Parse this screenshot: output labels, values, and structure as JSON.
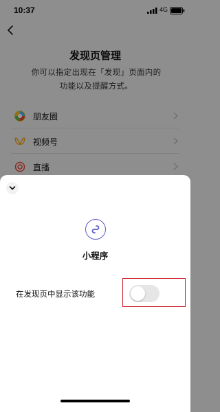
{
  "status_bar": {
    "time": "10:37",
    "network": "4G"
  },
  "nav": {
    "back_icon": "chevron-left-icon"
  },
  "page": {
    "title": "发现页管理",
    "description": "你可以指定出现在「发现」页面内的功能以及提醒方式。"
  },
  "menu": {
    "items": [
      {
        "label": "朋友圈",
        "icon": "moments-icon"
      },
      {
        "label": "视频号",
        "icon": "channels-icon"
      },
      {
        "label": "直播",
        "icon": "live-icon"
      }
    ]
  },
  "sheet": {
    "collapse_icon": "chevron-down-icon",
    "feature_icon": "mini-program-icon",
    "title": "小程序",
    "setting_label": "在发现页中显示该功能",
    "toggle_on": false
  },
  "colors": {
    "accent": "#5b5bc9",
    "highlight": "#cc1f2a",
    "toggle_off": "#e6e6e6"
  }
}
